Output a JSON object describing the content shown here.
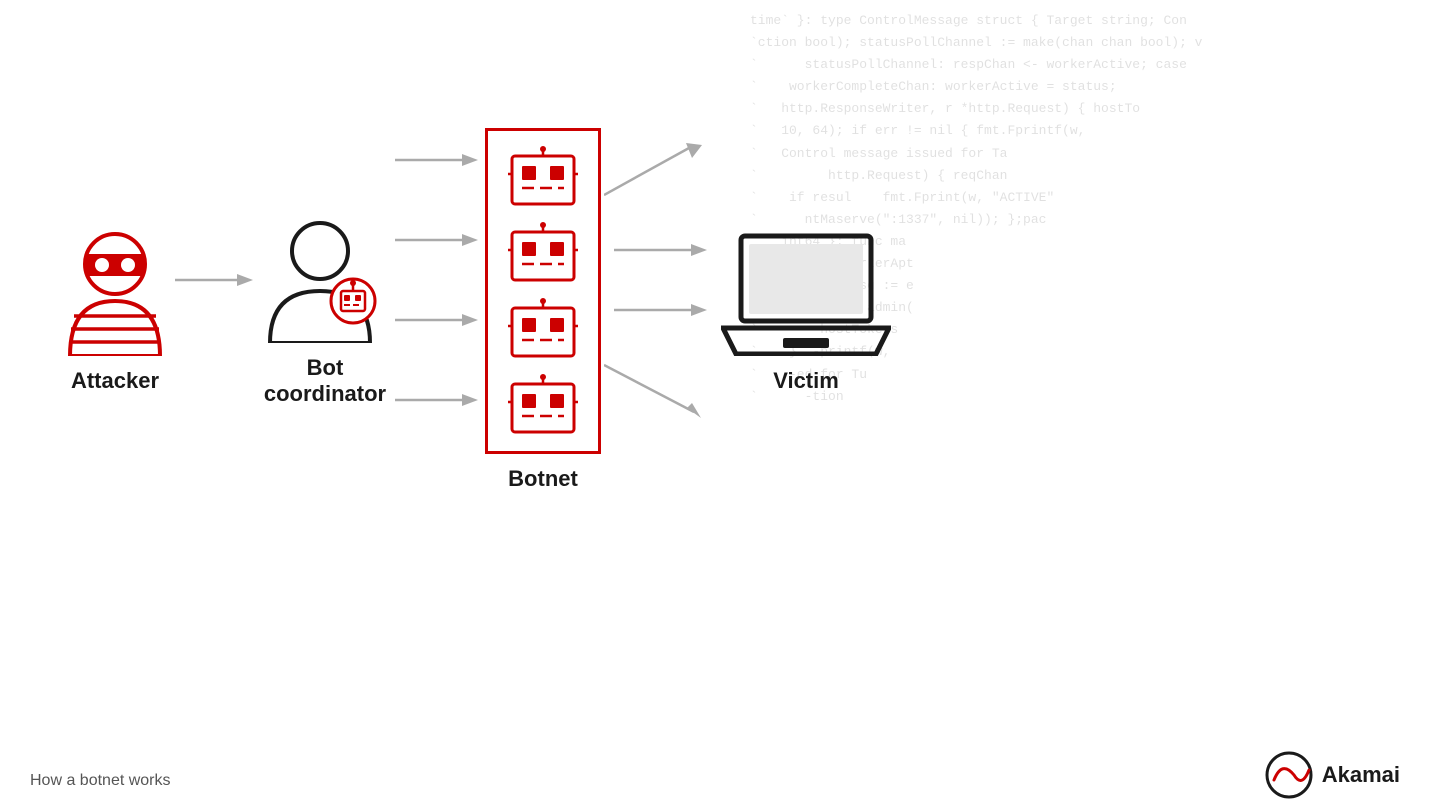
{
  "background_code": "time` }: type ControlMessage struct { Target string; Con\n`ction bool); statusPollChannel := make(chan chan bool); v\n`      statusPollChannel: respChan <- workerActive; case\n`    workerCompleteChan: workerActive = status;\n`   http.ResponseWriter, r *http.Request) { hostTo\n`   10, 64); if err != nil { fmt.Fprintf(w,\n`   Control message issued for Ta\n`         http.Request) { reqChan\n`    if resul    fmt.Fprint(w, \"ACTIVE\"\n`      ntMaserve(\":1337\", nil)); };pac\n`   int64 }: func ma\n`    bool): workerApt\n`  iver.case msg := e\n`   f(j); func admin(\n`        hostTokens\n`    }  -printf(w,\n`    -ed for Tu\n`      -tion",
  "attacker": {
    "label": "Attacker"
  },
  "bot_coordinator": {
    "label": "Bot\ncoordinator"
  },
  "botnet": {
    "label": "Botnet"
  },
  "victim": {
    "label": "Victim"
  },
  "caption": "How a botnet works",
  "issued_text": "Issued for Ta",
  "colors": {
    "red": "#cc0000",
    "dark": "#1a1a1a",
    "gray": "#999999",
    "arrow_gray": "#aaaaaa"
  },
  "akamai": {
    "text": "Akamai"
  }
}
